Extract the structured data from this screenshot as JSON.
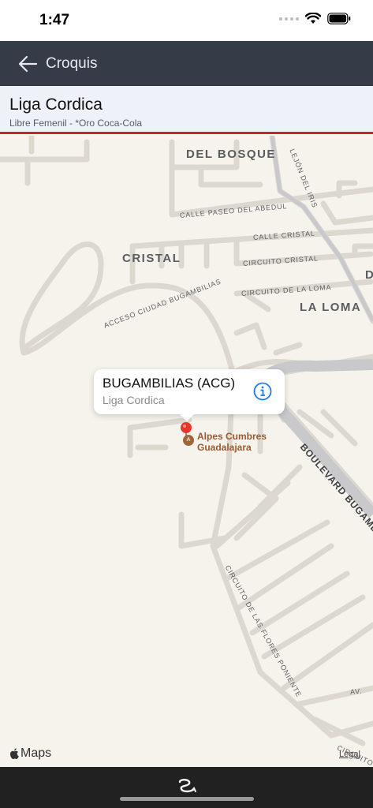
{
  "status_bar": {
    "time": "1:47"
  },
  "nav": {
    "title": "Croquis"
  },
  "header": {
    "title": "Liga Cordica",
    "subtitle": "Libre Femenil - *Oro Coca-Cola"
  },
  "map": {
    "areas": {
      "del_bosque": "DEL BOSQUE",
      "cristal": "CRISTAL",
      "la_loma": "LA LOMA",
      "edge_d": "D"
    },
    "streets": {
      "callejon_iris": "LEJÓN DEL IRIS",
      "paseo_abedul": "CALLE PASEO DEL ABEDUL",
      "calle_cristal": "CALLE CRISTAL",
      "circuito_cristal": "CIRCUITO CRISTAL",
      "circuito_loma": "CIRCUITO DE LA LOMA",
      "acceso_bugambilias": "ACCESO CIUDAD BUGAMBILIAS",
      "boulevard": "BOULEVARD BUGAMB",
      "circuito_flores": "CIRCUITO DE LAS FLORES PONIENTE",
      "av": "AV.",
      "circuito_edge": "CIRCUITO"
    },
    "poi": {
      "line1": "Alpes Cumbres",
      "line2": "Guadalajara",
      "icon_letter": "A"
    },
    "callout": {
      "title": "BUGAMBILIAS (ACG)",
      "subtitle": "Liga Cordica"
    },
    "attribution": "Maps",
    "legal": "Legal"
  },
  "icons": {
    "back": "arrow-left-icon",
    "info": "info-circle-icon",
    "pin": "map-pin-icon",
    "wifi": "wifi-icon",
    "battery": "battery-icon"
  },
  "colors": {
    "nav_bg": "#363b48",
    "header_bg": "#eef1f8",
    "accent_red": "#c0262d",
    "map_bg": "#f6f3ec",
    "info_blue": "#1a7cf5"
  }
}
